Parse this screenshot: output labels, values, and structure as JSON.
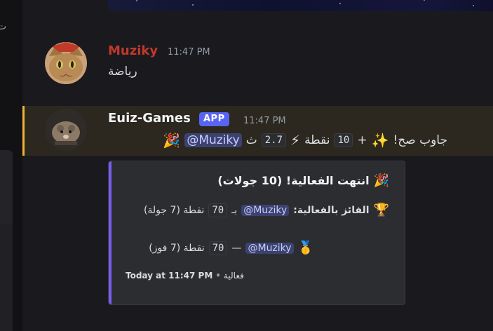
{
  "messages": [
    {
      "author": "Muziky",
      "author_color": "#c0392b",
      "time": "11:47 PM",
      "text": "رياضة"
    },
    {
      "author": "Euiz-Games",
      "badge": "APP",
      "time": "11:47 PM",
      "line": {
        "answer": "جاوب صح!",
        "plus": "+",
        "points": "10",
        "points_word": "نقطة",
        "speed": "2.7",
        "seconds": "ث",
        "mention": "@Muziky"
      }
    }
  ],
  "embed": {
    "title": "انتهت الفعالية! (10 جولات)",
    "winner_label": "الفائز بالفعالية:",
    "winner_mention": "@Muziky",
    "winner_by": "بـ",
    "winner_points": "70",
    "winner_suffix": "نقطة (7 جولة)",
    "rank_mention": "@Muziky",
    "rank_dash": "—",
    "rank_points": "70",
    "rank_suffix": "نقطة (7 فوز)",
    "footer_time": "Today at 11:47 PM",
    "footer_sep": "•",
    "footer_text": "فعالية",
    "accent": "#7b5cf0"
  },
  "icons": [
    "party-popper-icon",
    "sparkles-icon",
    "lightning-icon",
    "trophy-icon",
    "first-place-medal-icon"
  ]
}
